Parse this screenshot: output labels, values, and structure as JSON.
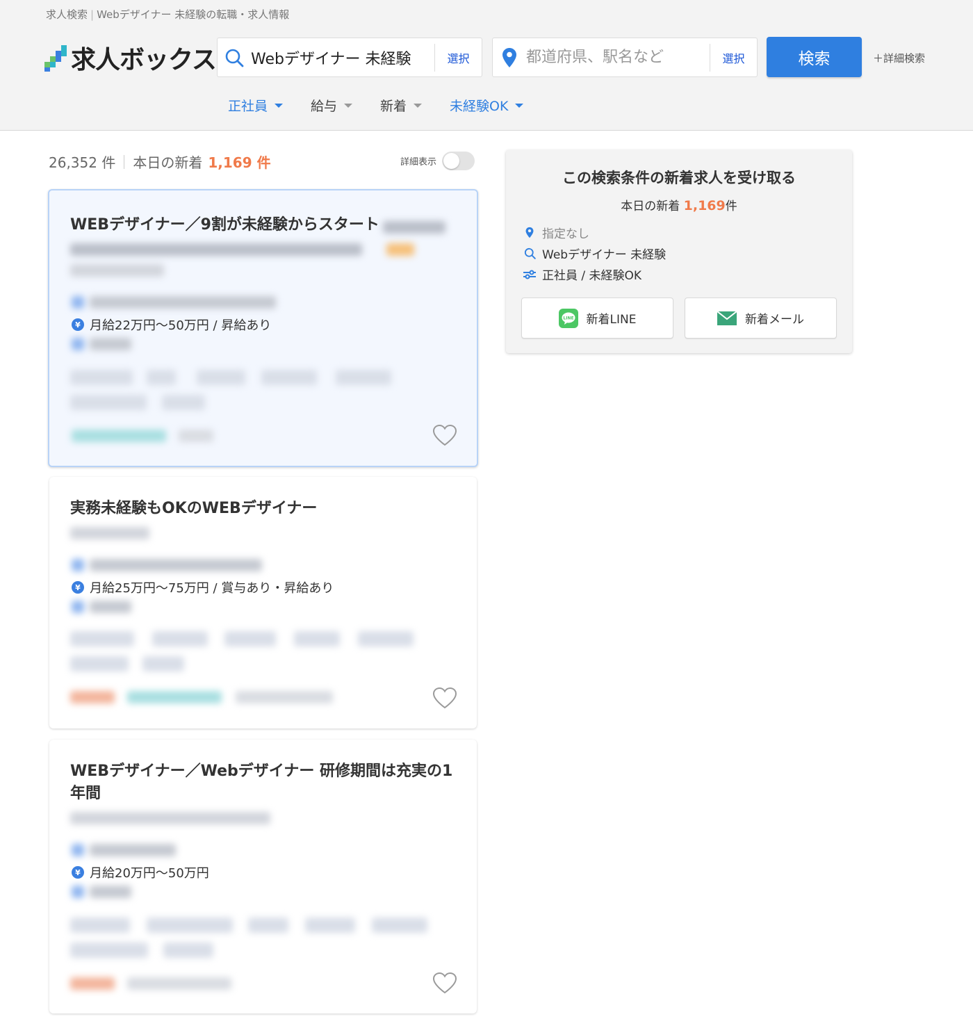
{
  "breadcrumb": {
    "home": "求人検索",
    "current": "Webデザイナー 未経験の転職・求人情報"
  },
  "logo": {
    "text": "求人ボックス"
  },
  "search": {
    "keyword_value": "Webデザイナー 未経験",
    "keyword_select": "選択",
    "location_placeholder": "都道府県、駅名など",
    "location_select": "選択",
    "submit": "検索",
    "advanced": "＋詳細検索"
  },
  "filters": [
    {
      "label": "正社員",
      "active": true
    },
    {
      "label": "給与",
      "active": false
    },
    {
      "label": "新着",
      "active": false
    },
    {
      "label": "未経験OK",
      "active": true
    }
  ],
  "summary": {
    "total": "26,352 件",
    "new_label": "本日の新着",
    "new_count": "1,169 件"
  },
  "detail_toggle": {
    "label": "詳細表示",
    "on": false
  },
  "jobs": [
    {
      "title": "WEBデザイナー／9割が未経験からスタート",
      "salary": "月給22万円〜50万円 / 昇給あり"
    },
    {
      "title": "実務未経験もOKのWEBデザイナー",
      "salary": "月給25万円〜75万円 / 賞与あり・昇給あり"
    },
    {
      "title": "WEBデザイナー／Webデザイナー 研修期間は充実の1年間",
      "salary": "月給20万円〜50万円"
    }
  ],
  "sidebar": {
    "title": "この検索条件の新着求人を受け取る",
    "count_label": "本日の新着",
    "count_value": "1,169",
    "count_unit": "件",
    "conditions": {
      "location": "指定なし",
      "keyword": "Webデザイナー 未経験",
      "filters": "正社員 / 未経験OK"
    },
    "line_button": "新着LINE",
    "mail_button": "新着メール"
  },
  "colors": {
    "accent": "#2f7fe0",
    "highlight": "#f07a4a",
    "line_green": "#4cc764",
    "mail_green": "#3aa57a"
  },
  "icons": [
    "search-icon",
    "location-pin-icon",
    "yen-icon",
    "heart-icon",
    "filter-sliders-icon",
    "line-icon",
    "mail-icon"
  ]
}
